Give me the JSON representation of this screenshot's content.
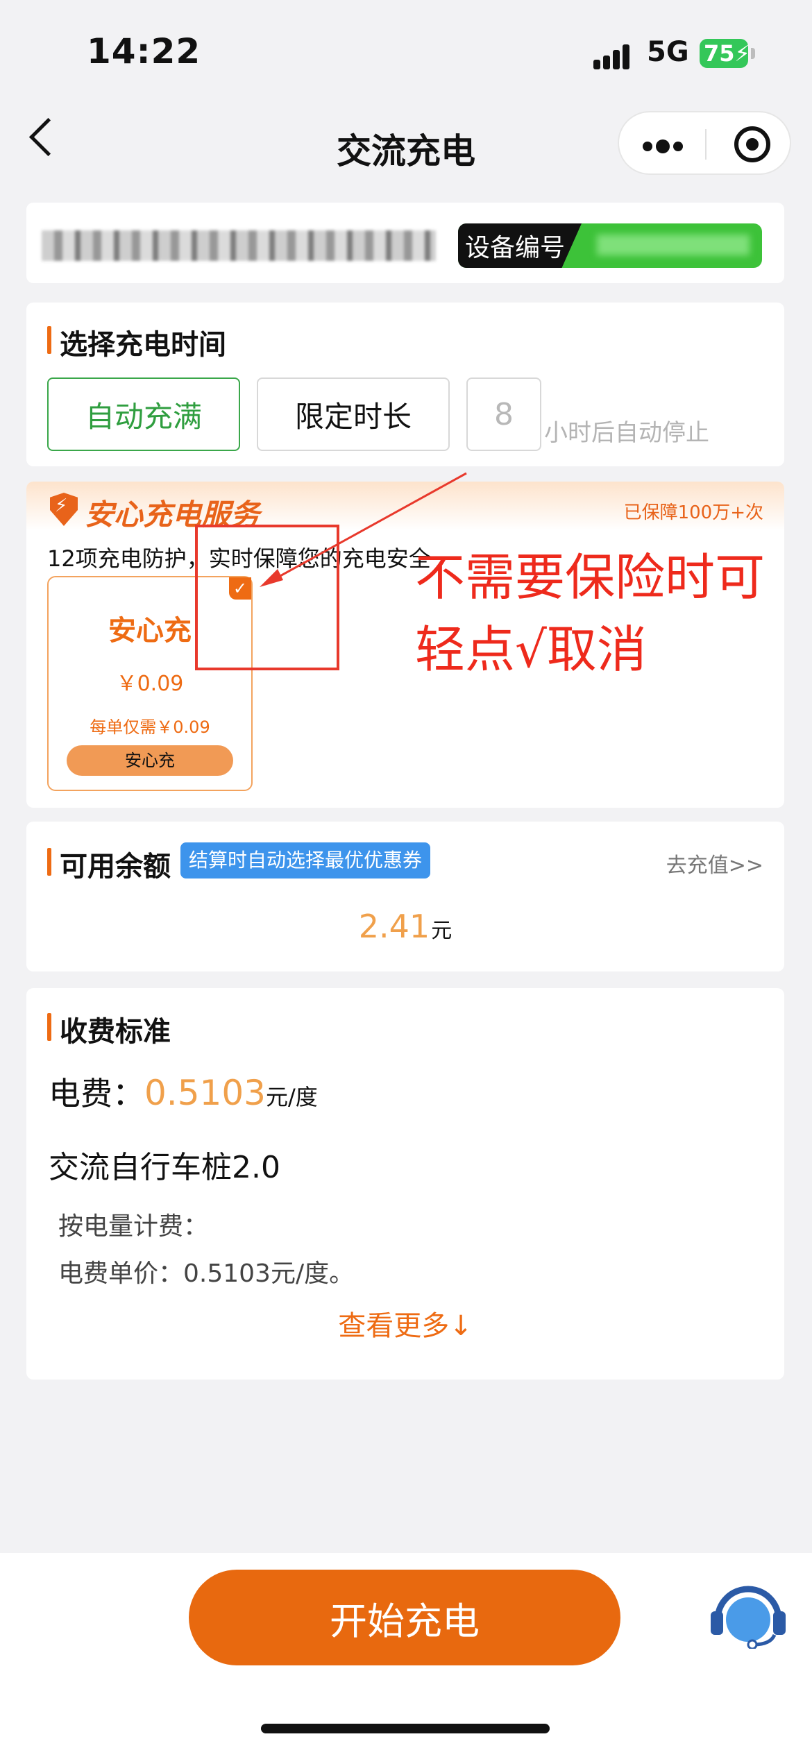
{
  "status": {
    "time": "14:22",
    "network": "5G",
    "battery": "75"
  },
  "nav": {
    "title": "交流充电"
  },
  "station": {
    "name": "",
    "device_label": "设备编号",
    "device_id": ""
  },
  "time_select": {
    "title": "选择充电时间",
    "options": [
      "自动充满",
      "限定时长"
    ],
    "selected": "自动充满",
    "hours_value": "8",
    "hours_hint": "小时后自动停止"
  },
  "insurance": {
    "title": "安心充电服务",
    "guarantee": "已保障100万+次",
    "description": "12项充电防护，实时保障您的充电安全",
    "plan": {
      "name": "安心充",
      "price": "￥0.09",
      "per_order": "每单仅需￥0.09",
      "button": "安心充",
      "checked": true
    }
  },
  "annotation": {
    "line1": "不需要保险时可",
    "line2": "轻点√取消",
    "color": "#ee2a1c"
  },
  "balance": {
    "title": "可用余额",
    "badge": "结算时自动选择最优优惠券",
    "topup": "去充值>>",
    "amount": "2.41",
    "unit": "元"
  },
  "fee": {
    "title": "收费标准",
    "label": "电费：",
    "price": "0.5103",
    "price_unit": "元/度",
    "pile_type": "交流自行车桩2.0",
    "rule_title": "按电量计费：",
    "rule_detail": "电费单价：0.5103元/度。",
    "more": "查看更多↓"
  },
  "footer": {
    "start_button": "开始充电",
    "accent": "#e8690f"
  }
}
